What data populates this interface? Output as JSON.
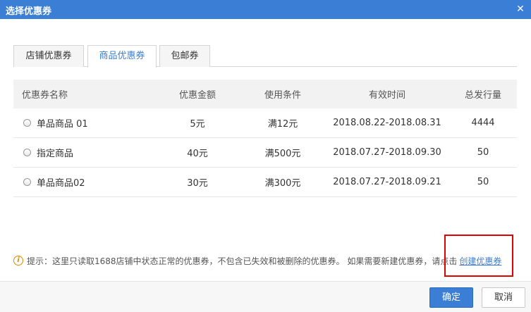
{
  "dialog": {
    "title": "选择优惠券",
    "close_glyph": "✕"
  },
  "tabs": [
    {
      "label": "店铺优惠券",
      "active": false
    },
    {
      "label": "商品优惠券",
      "active": true
    },
    {
      "label": "包邮券",
      "active": false
    }
  ],
  "table": {
    "headers": {
      "name": "优惠券名称",
      "amount": "优惠金额",
      "condition": "使用条件",
      "valid_time": "有效时间",
      "total": "总发行量"
    },
    "rows": [
      {
        "name": "单品商品 01",
        "amount": "5元",
        "condition": "满12元",
        "valid_time": "2018.08.22-2018.08.31",
        "total": "4444"
      },
      {
        "name": "指定商品",
        "amount": "40元",
        "condition": "满500元",
        "valid_time": "2018.07.27-2018.09.30",
        "total": "50"
      },
      {
        "name": "单品商品02",
        "amount": "30元",
        "condition": "满300元",
        "valid_time": "2018.07.27-2018.09.21",
        "total": "50"
      }
    ]
  },
  "tip": {
    "icon_glyph": "i",
    "text": "提示：这里只读取1688店铺中状态正常的优惠券，不包含已失效和被删除的优惠券。 如果需要新建优惠券，请点击",
    "link": "创建优惠券"
  },
  "footer": {
    "ok_label": "确定",
    "cancel_label": "取消"
  },
  "colors": {
    "title_bar": "#3a7fd5",
    "active_tab": "#3a7fd5",
    "link": "#3a7fd5",
    "highlight_border": "#e00000"
  }
}
